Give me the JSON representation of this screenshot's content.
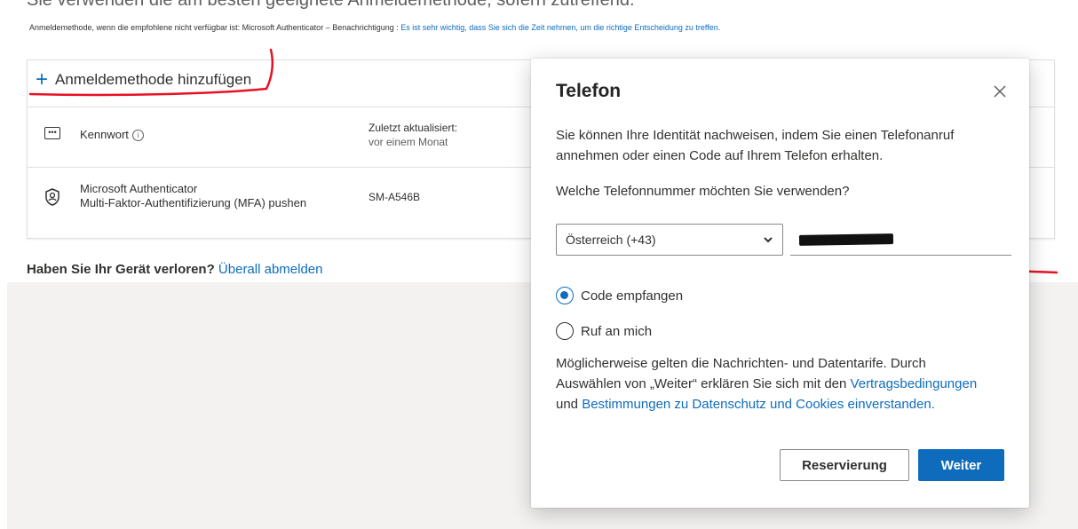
{
  "background": {
    "heading_cut": "Sie verwenden die am besten geeignete Anmeldemethode, sofern zutreffend.",
    "subline_prefix": "Anmeldemethode, wenn die empfohlene nicht verfügbar ist: Microsoft Authenticator – Benachrichtigung :",
    "subline_link": "Es ist sehr wichtig, dass Sie sich die Zeit nehmen, um die richtige Entscheidung zu treffen.",
    "add_method_label": "Anmeldemethode hinzufügen",
    "methods": [
      {
        "icon": "password-dots-icon",
        "label": "Kennwort",
        "detail_line1": "Zuletzt aktualisiert:",
        "detail_line2": "vor einem Monat"
      },
      {
        "icon": "authenticator-icon",
        "label_line1": "Microsoft Authenticator",
        "label_line2": "Multi-Faktor-Authentifizierung (MFA) pushen",
        "detail": "SM-A546B"
      }
    ],
    "lost_device_question": "Haben Sie Ihr Gerät verloren?",
    "sign_out_everywhere": "Überall abmelden"
  },
  "dialog": {
    "title": "Telefon",
    "intro": "Sie können Ihre Identität nachweisen, indem Sie einen Telefonanruf annehmen oder einen Code auf Ihrem Telefon erhalten.",
    "question": "Welche Telefonnummer möchten Sie verwenden?",
    "country_select_value": "Österreich (+43)",
    "phone_value": "",
    "options": [
      {
        "label": "Code empfangen",
        "selected": true
      },
      {
        "label": "Ruf an mich",
        "selected": false
      }
    ],
    "disclaimer_prefix": "Möglicherweise gelten die Nachrichten- und Datentarife. Durch Auswählen von „Weiter“ erklären Sie sich mit den",
    "terms_link": "Vertragsbedingungen",
    "and_text": "und",
    "privacy_link": "Bestimmungen zu Datenschutz und Cookies einverstanden.",
    "secondary_button": "Reservierung",
    "primary_button": "Weiter"
  },
  "colors": {
    "accent": "#0f6cbd",
    "annotation_red": "#e81123",
    "overlay": "#f3f2f1"
  }
}
